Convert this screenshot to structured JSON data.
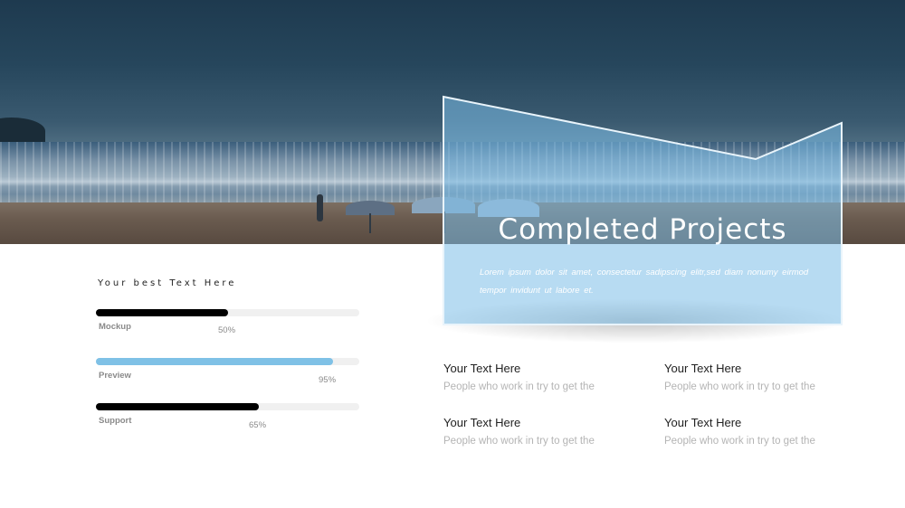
{
  "panel": {
    "title": "Completed Projects",
    "body": "Lorem  ipsum  dolor  sit  amet,  consectetur  sadipscing  elitr,sed  diam  nonumy  eirmod  tempor  invidunt   ut  labore  et."
  },
  "skills": {
    "title": "Your best Text Here",
    "items": [
      {
        "label": "Mockup",
        "percent_text": "50%",
        "value": 0.5,
        "color": "#000000"
      },
      {
        "label": "Preview",
        "percent_text": "95%",
        "value": 0.9,
        "color": "#7fc1e6"
      },
      {
        "label": "Support",
        "percent_text": "65%",
        "value": 0.62,
        "color": "#000000"
      }
    ]
  },
  "blocks": [
    {
      "heading": "Your Text Here",
      "text": "People who work in try to get the of."
    },
    {
      "heading": "Your Text Here",
      "text": "People who work in try to get the of."
    },
    {
      "heading": "Your Text Here",
      "text": "People who work in try to get the of."
    },
    {
      "heading": "Your Text Here",
      "text": "People who work in try to get the of."
    }
  ],
  "colors": {
    "accent": "#7fc1e6",
    "dark": "#000000",
    "track": "#f0f0f0"
  }
}
